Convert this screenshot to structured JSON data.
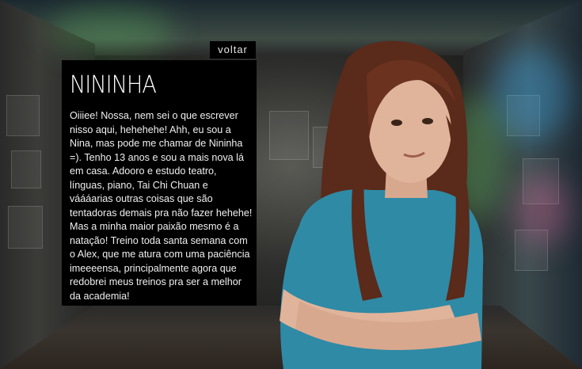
{
  "nav": {
    "back_label": "voltar"
  },
  "profile": {
    "name": "NININHA",
    "bio": "Oiiiee! Nossa, nem sei o que escrever nisso aqui, hehehehe! Ahh, eu sou a Nina, mas pode me chamar de Nininha =). Tenho 13 anos e sou a mais nova lá em casa. Adooro e estudo teatro, línguas, piano, Tai Chi Chuan e váááarias outras coisas que são tentadoras demais pra não fazer hehehe! Mas a minha maior paixão mesmo é a natação! Treino toda santa semana com o Alex, que me atura com uma paciência imeeeensa, principalmente agora que redobrei meus treinos pra ser a melhor da academia!"
  },
  "colors": {
    "panel_bg": "#000000",
    "text": "#f0f0f0",
    "shirt": "#2f8aa6",
    "hair": "#5a2a1a",
    "skin": "#e0b49a",
    "glow_green": "#7dff7a",
    "glow_blue": "#3fb7ff",
    "glow_pink": "#ff6fb0"
  }
}
